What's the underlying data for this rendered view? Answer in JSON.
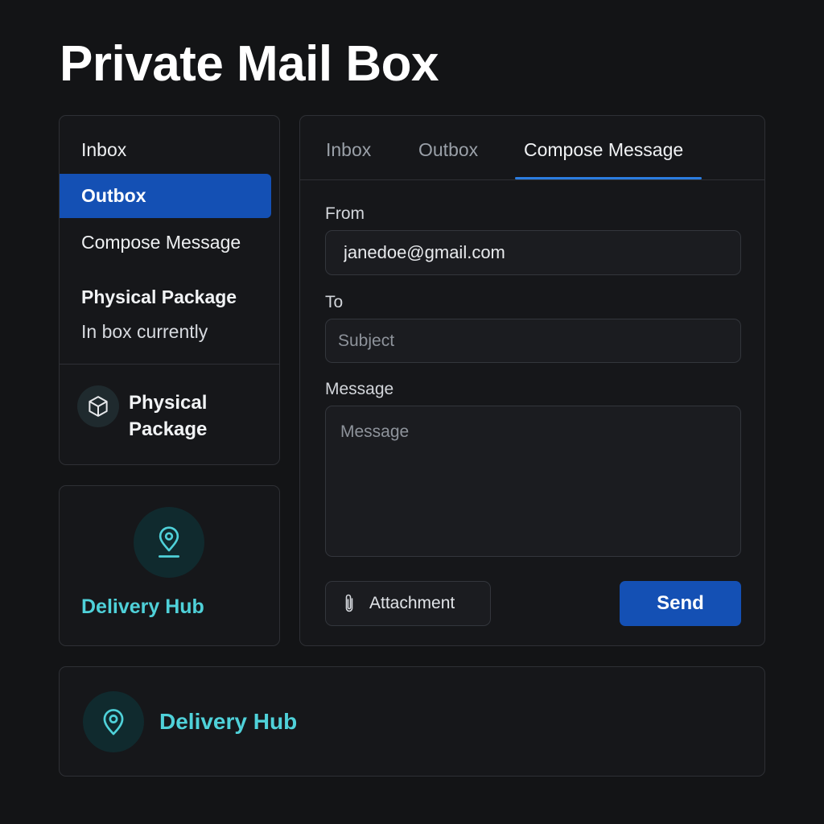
{
  "page": {
    "title": "Private Mail Box"
  },
  "sidebar": {
    "items": [
      {
        "label": "Inbox"
      },
      {
        "label": "Outbox",
        "active": true
      },
      {
        "label": "Compose Message"
      }
    ],
    "package": {
      "title": "Physical Package",
      "status": "In box currently",
      "badge_icon": "package-icon",
      "badge_label": "Physical Package"
    }
  },
  "hub_card": {
    "icon": "map-pin-icon",
    "label": "Delivery Hub"
  },
  "compose": {
    "tabs": [
      {
        "label": "Inbox"
      },
      {
        "label": "Outbox"
      },
      {
        "label": "Compose Message",
        "active": true
      }
    ],
    "from": {
      "label": "From",
      "value": "janedoe@gmail.com"
    },
    "to": {
      "label": "To",
      "placeholder": "Subject"
    },
    "message": {
      "label": "Message",
      "placeholder": "Message"
    },
    "attachment_label": "Attachment",
    "attachment_icon": "paperclip-icon",
    "send_label": "Send"
  },
  "bottom_bar": {
    "icon": "map-pin-icon",
    "label": "Delivery Hub"
  },
  "colors": {
    "accent": "#1450b4",
    "tab_indicator": "#2b7de0",
    "hub_teal": "#4fd1d9",
    "background": "#131416"
  }
}
